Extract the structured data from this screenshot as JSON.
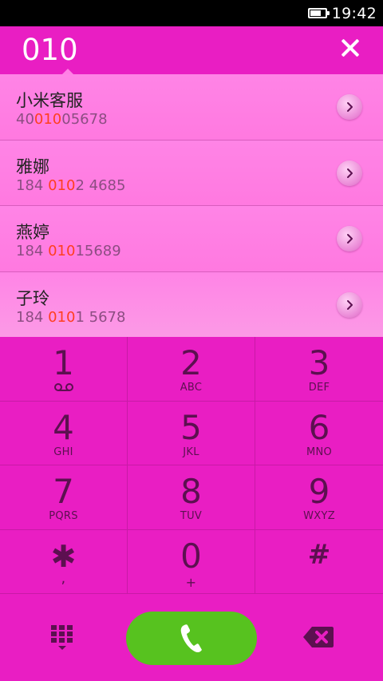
{
  "status_bar": {
    "time": "19:42",
    "battery_level": 0.75,
    "battery_icon": "battery-icon"
  },
  "dialer": {
    "dialed_number": "010",
    "close_icon": "close-icon"
  },
  "contacts": [
    {
      "name": "小米客服",
      "number_pre": "40",
      "number_match": "010",
      "number_post": "05678"
    },
    {
      "name": "雅娜",
      "number_pre": "184 ",
      "number_match": "010",
      "number_post": "2 4685"
    },
    {
      "name": "燕婷",
      "number_pre": "184 ",
      "number_match": "010",
      "number_post": "15689"
    },
    {
      "name": "子玲",
      "number_pre": "184 ",
      "number_match": "010",
      "number_post": "1 5678"
    }
  ],
  "keypad": [
    {
      "digit": "1",
      "letters": ""
    },
    {
      "digit": "2",
      "letters": "ABC"
    },
    {
      "digit": "3",
      "letters": "DEF"
    },
    {
      "digit": "4",
      "letters": "GHI"
    },
    {
      "digit": "5",
      "letters": "JKL"
    },
    {
      "digit": "6",
      "letters": "MNO"
    },
    {
      "digit": "7",
      "letters": "PQRS"
    },
    {
      "digit": "8",
      "letters": "TUV"
    },
    {
      "digit": "9",
      "letters": "WXYZ"
    },
    {
      "digit": "✱",
      "letters": ","
    },
    {
      "digit": "0",
      "letters": "+"
    },
    {
      "digit": "#",
      "letters": ""
    }
  ],
  "colors": {
    "background": "#e91ec3",
    "list_background": "#ff7de2",
    "match_highlight": "#ff3f1f",
    "call_button": "#57c21f",
    "key_text": "#5c1050"
  },
  "icons": {
    "voicemail": "voicemail-icon",
    "dialpad": "dialpad-icon",
    "call": "phone-icon",
    "backspace": "backspace-icon",
    "detail": "chevron-right-icon"
  }
}
